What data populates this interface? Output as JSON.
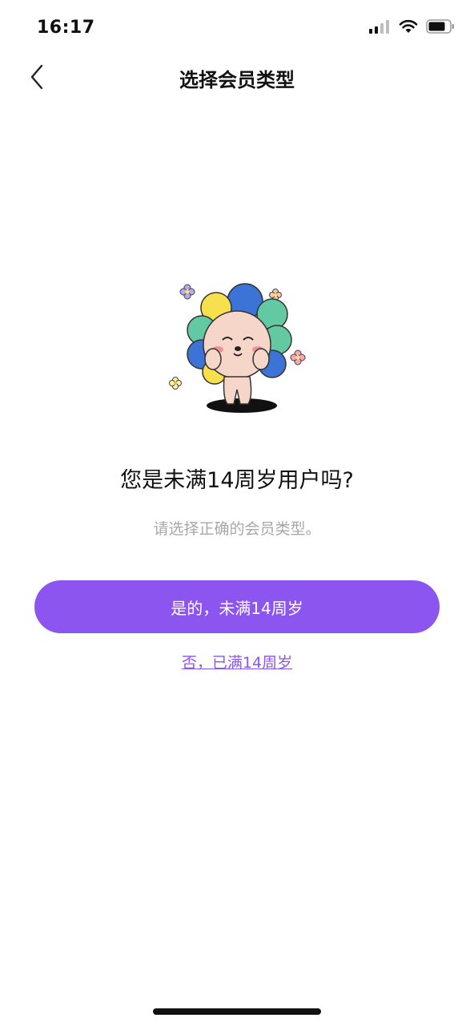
{
  "status_bar": {
    "time": "16:17"
  },
  "nav": {
    "title": "选择会员类型"
  },
  "content": {
    "question": "您是未满14周岁用户吗?",
    "subtitle": "请选择正确的会员类型。",
    "yes_button": "是的，未满14周岁",
    "no_link": "否，已满14周岁"
  },
  "colors": {
    "accent": "#8c55f0",
    "subtitle": "#a8a8a8",
    "text": "#111111"
  },
  "icons": [
    "back-chevron-icon",
    "signal-icon",
    "wifi-icon",
    "battery-icon"
  ]
}
